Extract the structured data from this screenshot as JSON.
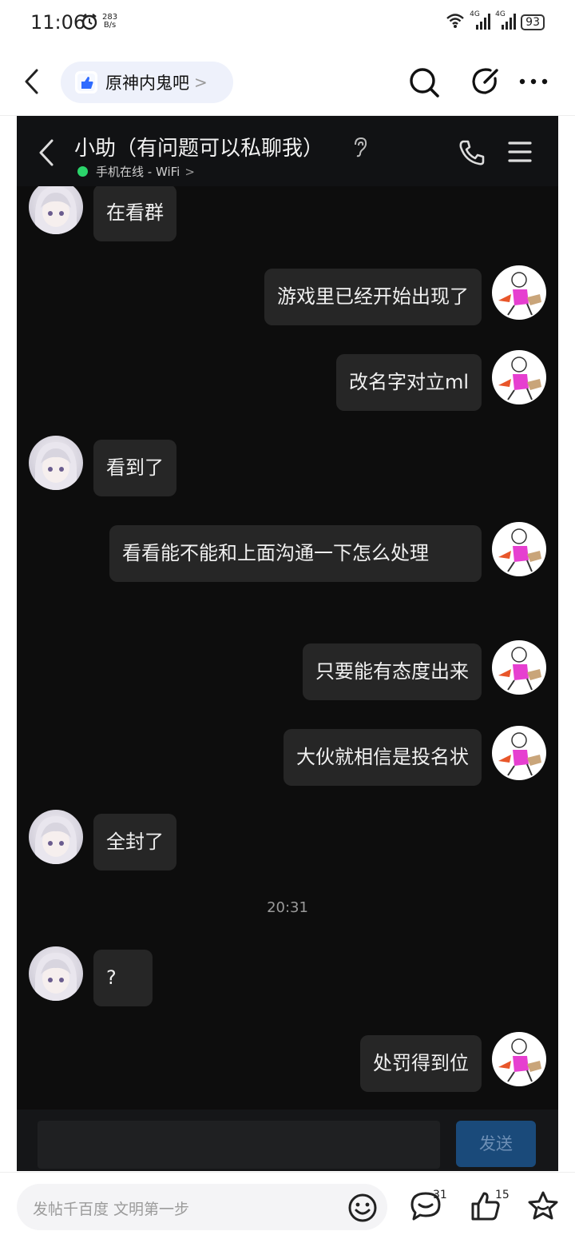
{
  "status_bar": {
    "time": "11:06",
    "net_speed_value": "283",
    "net_speed_unit": "B/s",
    "net1": "4G",
    "net2": "4G",
    "battery": "93"
  },
  "top_nav": {
    "forum_name": "原神内鬼吧",
    "forum_chevron": ">"
  },
  "chat": {
    "title": "小助（有问题可以私聊我）",
    "status": "手机在线 - WiFi",
    "status_chevron": ">",
    "messages": [
      {
        "side": "left",
        "text": "在看群"
      },
      {
        "side": "right",
        "text": "游戏里已经开始出现了"
      },
      {
        "side": "right",
        "text": "改名字对立ml"
      },
      {
        "side": "left",
        "text": "看到了"
      },
      {
        "side": "right",
        "text": "看看能不能和上面沟通一下怎么处理"
      },
      {
        "side": "right",
        "text": "只要能有态度出来"
      },
      {
        "side": "right",
        "text": "大伙就相信是投名状"
      },
      {
        "side": "left",
        "text": "全封了"
      },
      {
        "side": "left",
        "text": "?"
      },
      {
        "side": "right",
        "text": "处罚得到位"
      }
    ],
    "timestamp": "20:31",
    "send_label": "发送"
  },
  "bottom_bar": {
    "reply_placeholder": "发帖千百度 文明第一步",
    "comment_count": "31",
    "like_count": "15"
  },
  "icons": {
    "back": "chevron-left-icon",
    "search": "search-icon",
    "edit": "edit-icon",
    "more": "more-icon",
    "ear": "ear-icon",
    "phone": "phone-icon",
    "menu": "menu-icon",
    "emoji": "emoji-icon",
    "comment": "comment-icon",
    "like": "thumbs-up-icon",
    "favorite": "star-icon"
  },
  "colors": {
    "online_dot": "#2bd46b",
    "chat_background": "#0d0d0d",
    "bubble": "#262626",
    "send_button": "#1a4a7a",
    "self_avatar_figure": "#e63fd0"
  }
}
